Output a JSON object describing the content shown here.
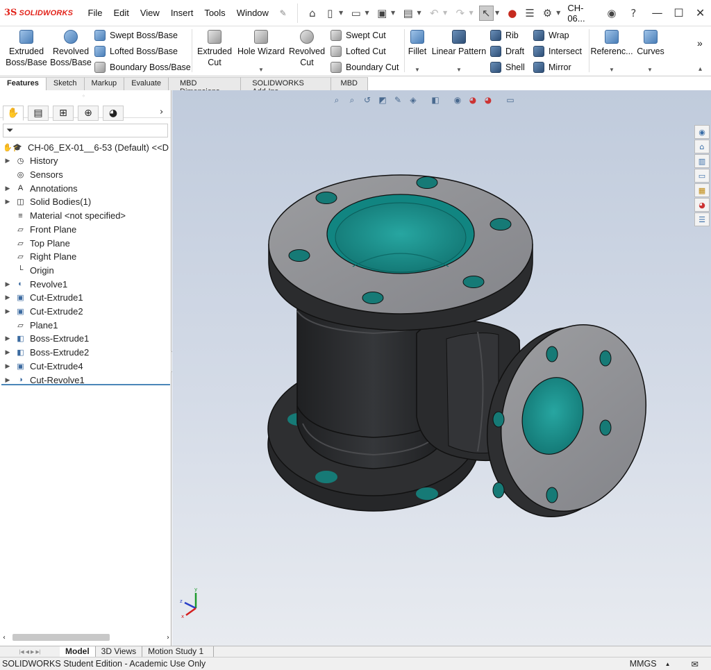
{
  "app": {
    "brand_ds": "3S",
    "brand_word": "SOLIDWORKS",
    "doc_title": "CH-06..."
  },
  "menu": [
    "File",
    "Edit",
    "View",
    "Insert",
    "Tools",
    "Window"
  ],
  "ribbon": {
    "extruded_boss": [
      "Extruded",
      "Boss/Base"
    ],
    "revolved_boss": [
      "Revolved",
      "Boss/Base"
    ],
    "swept_boss": "Swept Boss/Base",
    "lofted_boss": "Lofted Boss/Base",
    "boundary_boss": "Boundary Boss/Base",
    "extruded_cut": [
      "Extruded",
      "Cut"
    ],
    "hole_wizard": "Hole Wizard",
    "revolved_cut": [
      "Revolved",
      "Cut"
    ],
    "swept_cut": "Swept Cut",
    "lofted_cut": "Lofted Cut",
    "boundary_cut": "Boundary Cut",
    "fillet": "Fillet",
    "linear_pattern": "Linear Pattern",
    "rib": "Rib",
    "draft": "Draft",
    "shell": "Shell",
    "wrap": "Wrap",
    "intersect": "Intersect",
    "mirror": "Mirror",
    "reference": "Referenc...",
    "curves": "Curves",
    "more": "»"
  },
  "command_tabs": [
    "Features",
    "Sketch",
    "Markup",
    "Evaluate",
    "MBD Dimensions",
    "SOLIDWORKS Add-Ins",
    "MBD"
  ],
  "tree": {
    "root": "CH-06_EX-01__6-53 (Default) <<D",
    "items": [
      {
        "label": "History",
        "expandable": true
      },
      {
        "label": "Sensors",
        "expandable": false
      },
      {
        "label": "Annotations",
        "expandable": true
      },
      {
        "label": "Solid Bodies(1)",
        "expandable": true
      },
      {
        "label": "Material <not specified>",
        "expandable": false
      },
      {
        "label": "Front Plane",
        "expandable": false
      },
      {
        "label": "Top Plane",
        "expandable": false
      },
      {
        "label": "Right Plane",
        "expandable": false
      },
      {
        "label": "Origin",
        "expandable": false
      },
      {
        "label": "Revolve1",
        "expandable": true
      },
      {
        "label": "Cut-Extrude1",
        "expandable": true
      },
      {
        "label": "Cut-Extrude2",
        "expandable": true
      },
      {
        "label": "Plane1",
        "expandable": false
      },
      {
        "label": "Boss-Extrude1",
        "expandable": true
      },
      {
        "label": "Boss-Extrude2",
        "expandable": true
      },
      {
        "label": "Cut-Extrude4",
        "expandable": true
      },
      {
        "label": "Cut-Revolve1",
        "expandable": true
      }
    ]
  },
  "bottom_tabs": [
    "Model",
    "3D Views",
    "Motion Study 1"
  ],
  "status": {
    "text": "SOLIDWORKS Student Edition - Academic Use Only",
    "units": "MMGS"
  },
  "triad": {
    "x": "x",
    "y": "y",
    "z": "z"
  },
  "colors": {
    "model_body": "#2c2d2f",
    "flange_face": "#8e8f92",
    "bore": "#1a8e8a",
    "brand_red": "#e2231a"
  }
}
